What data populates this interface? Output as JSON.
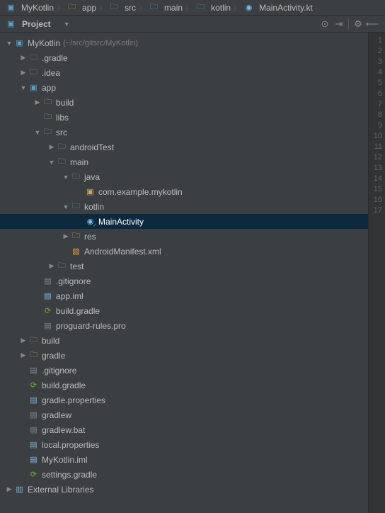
{
  "breadcrumb": [
    {
      "icon": "project",
      "label": "MyKotlin"
    },
    {
      "icon": "folder",
      "label": "app"
    },
    {
      "icon": "folder-blue",
      "label": "src"
    },
    {
      "icon": "folder-blue",
      "label": "main"
    },
    {
      "icon": "folder-blue",
      "label": "kotlin"
    },
    {
      "icon": "kt",
      "label": "MainActivity.kt"
    }
  ],
  "toolbar": {
    "view_label": "Project"
  },
  "tree": [
    {
      "depth": 0,
      "arrow": "down",
      "icon": "project",
      "label": "MyKotlin",
      "suffix": "(~/src/gitsrc/MyKotlin)"
    },
    {
      "depth": 1,
      "arrow": "right",
      "icon": "folder-red",
      "label": ".gradle"
    },
    {
      "depth": 1,
      "arrow": "right",
      "icon": "folder",
      "label": ".idea"
    },
    {
      "depth": 1,
      "arrow": "down",
      "icon": "project",
      "label": "app"
    },
    {
      "depth": 2,
      "arrow": "right",
      "icon": "folder",
      "label": "build"
    },
    {
      "depth": 2,
      "arrow": "none",
      "icon": "folder",
      "label": "libs"
    },
    {
      "depth": 2,
      "arrow": "down",
      "icon": "folder-blue",
      "label": "src"
    },
    {
      "depth": 3,
      "arrow": "right",
      "icon": "folder-teal",
      "label": "androidTest"
    },
    {
      "depth": 3,
      "arrow": "down",
      "icon": "folder-blue",
      "label": "main"
    },
    {
      "depth": 4,
      "arrow": "down",
      "icon": "folder-blue",
      "label": "java"
    },
    {
      "depth": 5,
      "arrow": "none",
      "icon": "pkg",
      "label": "com.example.mykotlin"
    },
    {
      "depth": 4,
      "arrow": "down",
      "icon": "folder-blue",
      "label": "kotlin"
    },
    {
      "depth": 5,
      "arrow": "none",
      "icon": "kt",
      "label": "MainActivity",
      "selected": true,
      "badge": true
    },
    {
      "depth": 4,
      "arrow": "right",
      "icon": "folder-yellow",
      "label": "res"
    },
    {
      "depth": 4,
      "arrow": "none",
      "icon": "xml",
      "label": "AndroidManifest.xml"
    },
    {
      "depth": 3,
      "arrow": "right",
      "icon": "folder-teal",
      "label": "test"
    },
    {
      "depth": 2,
      "arrow": "none",
      "icon": "file",
      "label": ".gitignore"
    },
    {
      "depth": 2,
      "arrow": "none",
      "icon": "file-iml",
      "label": "app.iml"
    },
    {
      "depth": 2,
      "arrow": "none",
      "icon": "gradle",
      "label": "build.gradle"
    },
    {
      "depth": 2,
      "arrow": "none",
      "icon": "file",
      "label": "proguard-rules.pro"
    },
    {
      "depth": 1,
      "arrow": "right",
      "icon": "folder",
      "label": "build"
    },
    {
      "depth": 1,
      "arrow": "right",
      "icon": "folder",
      "label": "gradle"
    },
    {
      "depth": 1,
      "arrow": "none",
      "icon": "file",
      "label": ".gitignore"
    },
    {
      "depth": 1,
      "arrow": "none",
      "icon": "gradle",
      "label": "build.gradle"
    },
    {
      "depth": 1,
      "arrow": "none",
      "icon": "file-prop",
      "label": "gradle.properties"
    },
    {
      "depth": 1,
      "arrow": "none",
      "icon": "file",
      "label": "gradlew"
    },
    {
      "depth": 1,
      "arrow": "none",
      "icon": "file",
      "label": "gradlew.bat"
    },
    {
      "depth": 1,
      "arrow": "none",
      "icon": "file-prop",
      "label": "local.properties"
    },
    {
      "depth": 1,
      "arrow": "none",
      "icon": "file-iml",
      "label": "MyKotlin.iml"
    },
    {
      "depth": 1,
      "arrow": "none",
      "icon": "gradle",
      "label": "settings.gradle"
    },
    {
      "depth": 0,
      "arrow": "right",
      "icon": "libs",
      "label": "External Libraries"
    }
  ],
  "gutter": {
    "start": 1,
    "end": 17
  }
}
